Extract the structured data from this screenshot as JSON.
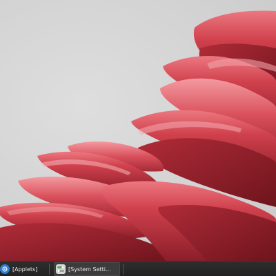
{
  "desktop": {
    "wallpaper": {
      "background_color": "#d6d6d6",
      "accent_color": "#c63a46",
      "shadow_color": "#7e1b24",
      "highlight_color": "#ee7a82"
    }
  },
  "taskbar": {
    "background_color": "#262626",
    "tasks": [
      {
        "label": "[Applets]",
        "icon": "applets-icon",
        "icon_color": "#2d7fd0"
      },
      {
        "label": "[System Setti...",
        "icon": "system-settings-icon",
        "icon_color": "#d7d7d7",
        "active": true
      }
    ]
  }
}
